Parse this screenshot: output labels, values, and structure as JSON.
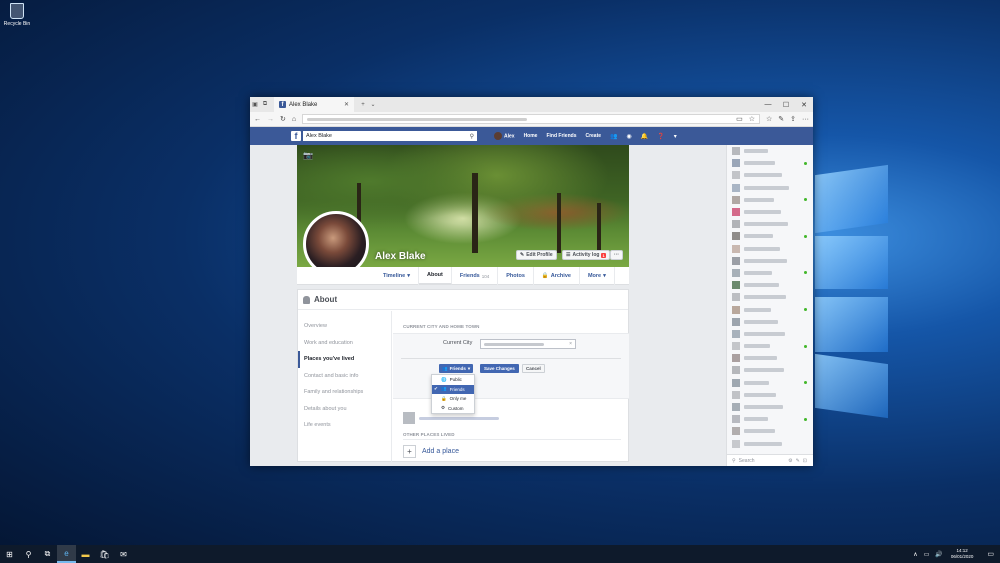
{
  "desktop": {
    "recycle_bin_label": "Recycle Bin"
  },
  "browser": {
    "tab_title": "Alex Blake",
    "tab_close": "✕",
    "new_tab": "+",
    "tab_menu": "⌄",
    "win_min": "—",
    "win_max": "☐",
    "win_close": "✕",
    "nav_back": "←",
    "nav_forward": "→",
    "nav_refresh": "↻",
    "nav_home": "⌂",
    "icons": [
      "reading-view-icon",
      "favorite-star-icon",
      "favorites-list-icon",
      "notes-icon",
      "share-icon",
      "more-icon"
    ]
  },
  "fb": {
    "logo": "f",
    "search_value": "Alex Blake",
    "nav_user": "Alex",
    "nav_home": "Home",
    "nav_find_friends": "Find Friends",
    "nav_create": "Create"
  },
  "profile": {
    "name": "Alex Blake",
    "edit_profile": "Edit Profile",
    "activity_log": "Activity log",
    "activity_badge": "1",
    "more_dots": "···",
    "tabs": {
      "timeline": "Timeline",
      "about": "About",
      "friends": "Friends",
      "friends_count": "104",
      "photos": "Photos",
      "archive": "Archive",
      "more": "More"
    }
  },
  "about": {
    "heading": "About",
    "sidebar": [
      "Overview",
      "Work and education",
      "Places you've lived",
      "Contact and basic info",
      "Family and relationships",
      "Details about you",
      "Life events"
    ],
    "section_header": "CURRENT CITY AND HOME TOWN",
    "current_city_label": "Current City",
    "clear_icon": "×",
    "audience_button": "Friends",
    "save_button": "Save Changes",
    "cancel_button": "Cancel",
    "audience_options": [
      "Public",
      "Friends",
      "Only me",
      "Custom"
    ],
    "audience_selected": "Friends",
    "other_places_header": "OTHER PLACES LIVED",
    "add_place": "Add a place",
    "add_plus": "+"
  },
  "chat": {
    "search_placeholder": "Search"
  },
  "taskbar": {
    "time": "14:12",
    "date": "06/01/2020"
  },
  "colors": {
    "fb_blue": "#3b5998",
    "button_blue": "#4267b2",
    "link_blue": "#365899",
    "online_green": "#42b72a",
    "badge_red": "#fa3e3e"
  }
}
